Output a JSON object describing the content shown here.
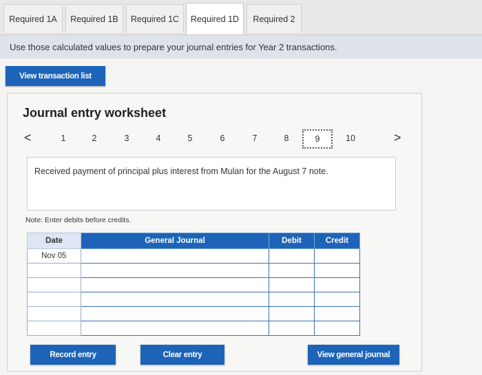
{
  "tabs": [
    {
      "label": "Required 1A",
      "active": false
    },
    {
      "label": "Required 1B",
      "active": false
    },
    {
      "label": "Required 1C",
      "active": false
    },
    {
      "label": "Required 1D",
      "active": true
    },
    {
      "label": "Required 2",
      "active": false
    }
  ],
  "instruction": "Use those calculated values to prepare your journal entries for Year 2 transactions.",
  "view_transaction_list_label": "View transaction list",
  "worksheet": {
    "title": "Journal entry worksheet",
    "pages": [
      "1",
      "2",
      "3",
      "4",
      "5",
      "6",
      "7",
      "8",
      "9",
      "10"
    ],
    "current_page": "9",
    "prev_icon": "<",
    "next_icon": ">",
    "description": "Received payment of principal plus interest from Mulan for the August 7 note.",
    "note": "Note: Enter debits before credits."
  },
  "journal": {
    "headers": {
      "date": "Date",
      "account": "General Journal",
      "debit": "Debit",
      "credit": "Credit"
    },
    "rows": [
      {
        "date": "Nov 05",
        "account": "",
        "debit": "",
        "credit": ""
      },
      {
        "date": "",
        "account": "",
        "debit": "",
        "credit": ""
      },
      {
        "date": "",
        "account": "",
        "debit": "",
        "credit": ""
      },
      {
        "date": "",
        "account": "",
        "debit": "",
        "credit": ""
      },
      {
        "date": "",
        "account": "",
        "debit": "",
        "credit": ""
      },
      {
        "date": "",
        "account": "",
        "debit": "",
        "credit": ""
      }
    ]
  },
  "buttons": {
    "record_entry": "Record entry",
    "clear_entry": "Clear entry",
    "view_general_journal": "View general journal"
  },
  "colors": {
    "accent": "#1d64b8"
  }
}
